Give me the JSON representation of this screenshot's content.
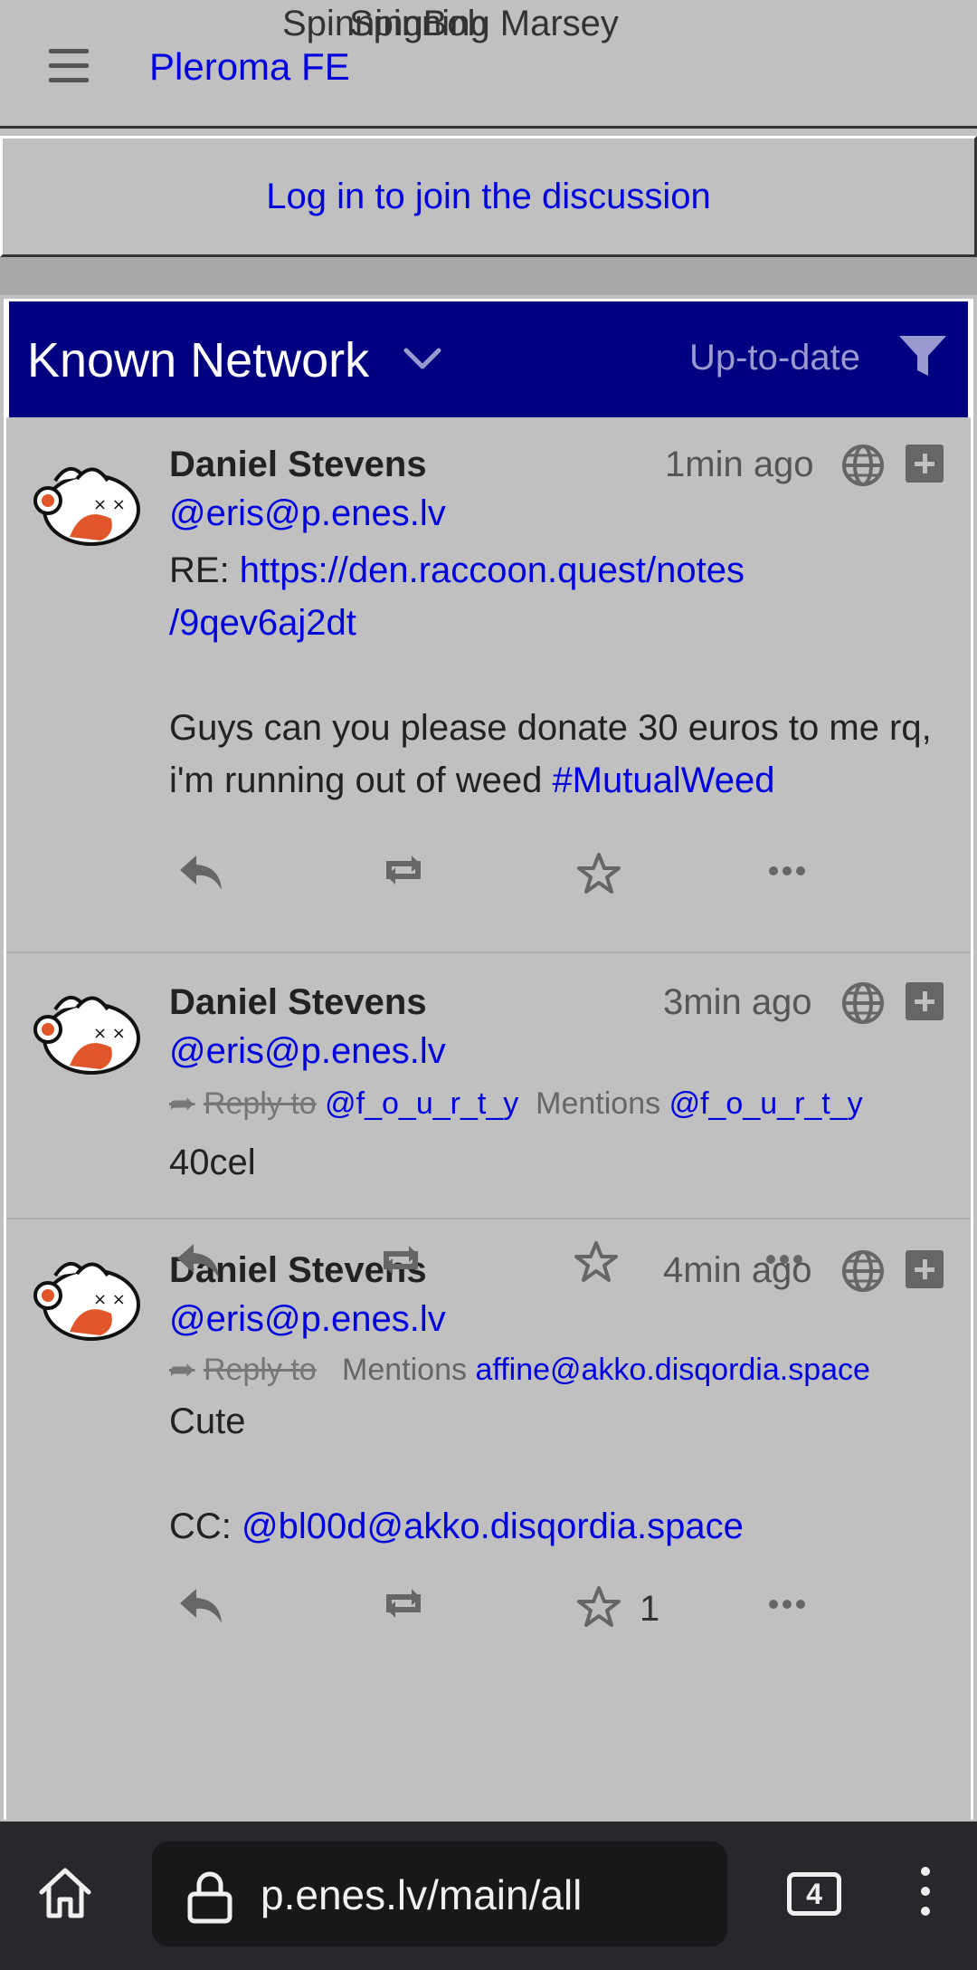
{
  "nav": {
    "title_overlap_a": "SpinningBob",
    "title_overlap_b": "Spinning Marsey",
    "site_name": "Pleroma FE"
  },
  "login": {
    "label": "Log in to join the discussion"
  },
  "timeline": {
    "title": "Known Network",
    "status_label": "Up-to-date"
  },
  "statuses": [
    {
      "author": "Daniel Stevens",
      "handle": "@eris@p.enes.lv",
      "time": "1min ago",
      "re_prefix": "RE: ",
      "re_link_line1": "https://den.raccoon.quest/notes",
      "re_link_line2": "/9qev6aj2dt",
      "text": "Guys can you please donate 30 euros to me rq, i'm running out of weed ",
      "hashtag": "#MutualWeed"
    },
    {
      "author": "Daniel Stevens",
      "handle": "@eris@p.enes.lv",
      "time": "3min ago",
      "reply_to_label": "Reply to",
      "reply_to_user": "@f_o_u_r_t_y",
      "mentions_label": "Mentions",
      "mentions_user": "@f_o_u_r_t_y",
      "text": "40cel"
    },
    {
      "author": "Daniel Stevens",
      "handle": "@eris@p.enes.lv",
      "time": "4min ago",
      "reply_to_label": "Reply to",
      "mentions_label": "Mentions",
      "mentions_user": "affine@akko.disqordia.space",
      "text": "Cute",
      "cc_prefix": "CC: ",
      "cc_link": "@bl00d@akko.disqordia.space",
      "favorite_count": "1"
    }
  ],
  "browser": {
    "url": "p.enes.lv/main/all",
    "tab_count": "4"
  },
  "colors": {
    "background": "#c0c0c0",
    "header": "#000080",
    "link": "#0000dd"
  }
}
